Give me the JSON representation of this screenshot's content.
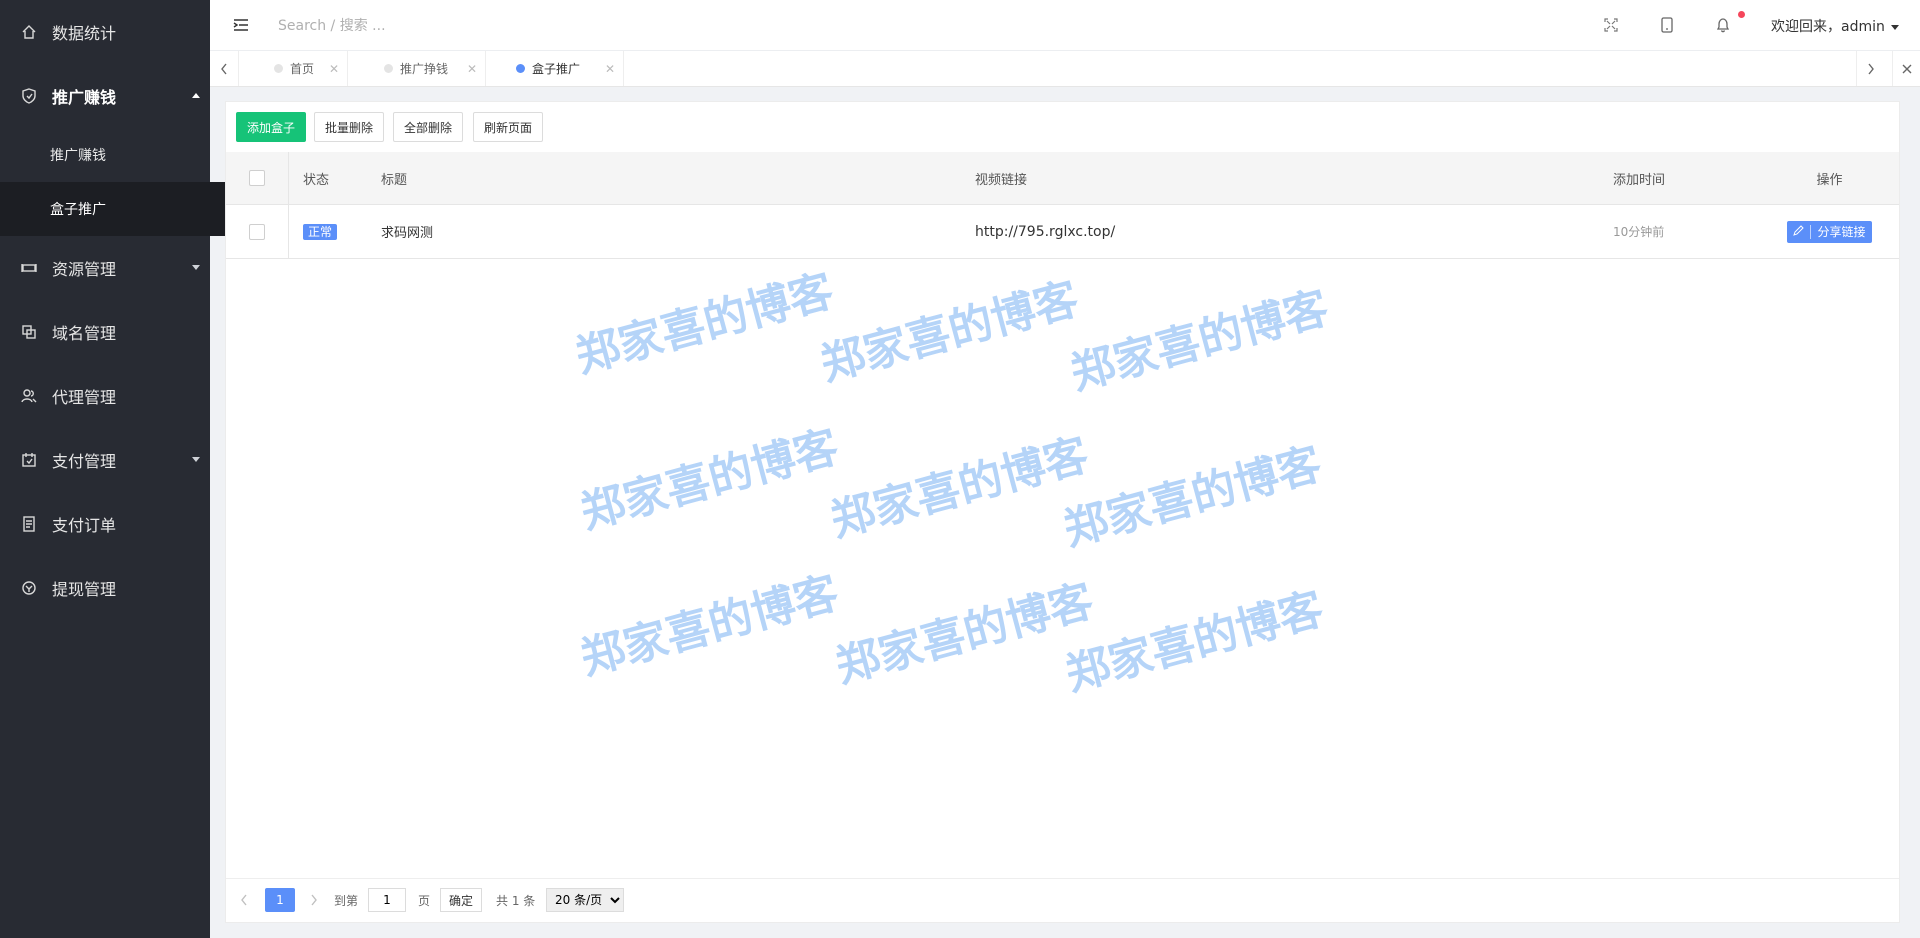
{
  "sidebar": {
    "items": [
      {
        "label": "数据统计",
        "icon": "home-icon"
      },
      {
        "label": "推广赚钱",
        "icon": "shield-icon",
        "open": true,
        "children": [
          {
            "label": "推广赚钱"
          },
          {
            "label": "盒子推广",
            "active": true
          }
        ]
      },
      {
        "label": "资源管理",
        "icon": "resource-icon",
        "has_children": true
      },
      {
        "label": "域名管理",
        "icon": "domain-icon"
      },
      {
        "label": "代理管理",
        "icon": "users-icon"
      },
      {
        "label": "支付管理",
        "icon": "calendar-icon",
        "has_children": true
      },
      {
        "label": "支付订单",
        "icon": "receipt-icon"
      },
      {
        "label": "提现管理",
        "icon": "withdraw-icon"
      }
    ]
  },
  "header": {
    "search_placeholder": "Search / 搜索 ...",
    "user_label": "欢迎回来，admin"
  },
  "tabs": [
    {
      "label": "首页",
      "active": false
    },
    {
      "label": "推广挣钱",
      "active": false
    },
    {
      "label": "盒子推广",
      "active": true
    }
  ],
  "toolbar": {
    "add": "添加盒子",
    "batch_delete": "批量删除",
    "delete_all": "全部删除",
    "refresh": "刷新页面"
  },
  "table": {
    "columns": {
      "status": "状态",
      "title": "标题",
      "video_link": "视频链接",
      "added_time": "添加时间",
      "actions": "操作"
    },
    "rows": [
      {
        "status": "正常",
        "title": "求码网测",
        "video_link": "http://795.rglxc.top/",
        "added_time": "10分钟前",
        "action": "分享链接"
      }
    ]
  },
  "watermark": "郑家喜的博客",
  "pagination": {
    "current": "1",
    "goto_label": "到第",
    "page_input": "1",
    "page_unit": "页",
    "confirm": "确定",
    "total": "共 1 条",
    "per_page": "20 条/页"
  },
  "colors": {
    "sidebar": "#282b33",
    "primary": "#5b8ff9",
    "add_button": "#16c378",
    "badge_dot": "#f5465b"
  }
}
